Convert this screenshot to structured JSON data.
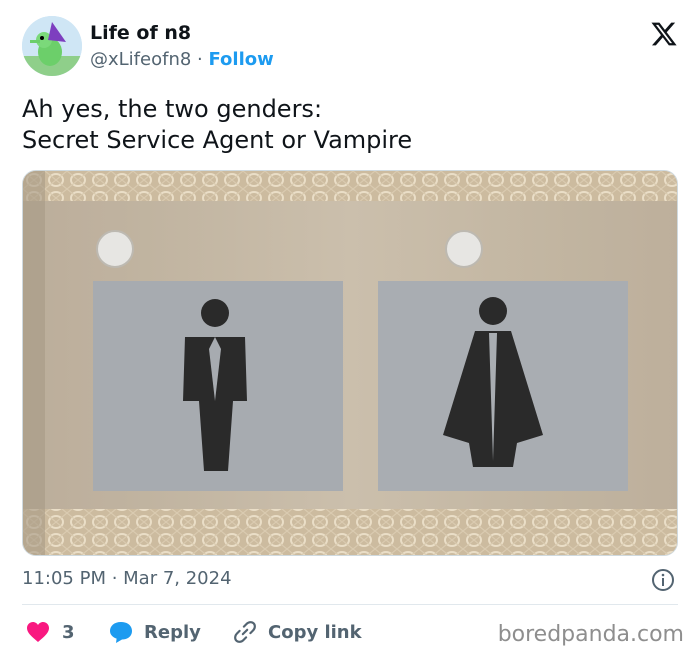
{
  "user": {
    "display_name": "Life of n8",
    "handle": "@xLifeofn8",
    "separator": " · ",
    "follow_label": "Follow"
  },
  "tweet": {
    "line1": "Ah yes, the two genders:",
    "line2": "Secret Service Agent or Vampire"
  },
  "meta": {
    "timestamp": "11:05 PM · Mar 7, 2024"
  },
  "actions": {
    "like_count": "3",
    "reply_label": "Reply",
    "copy_label": "Copy link"
  },
  "watermark": "boredpanda.com",
  "colors": {
    "accent": "#1d9bf0",
    "like": "#f91880",
    "muted": "#536471"
  },
  "icons": [
    "x-logo-icon",
    "info-icon",
    "heart-icon",
    "reply-bubble-icon",
    "link-icon"
  ]
}
